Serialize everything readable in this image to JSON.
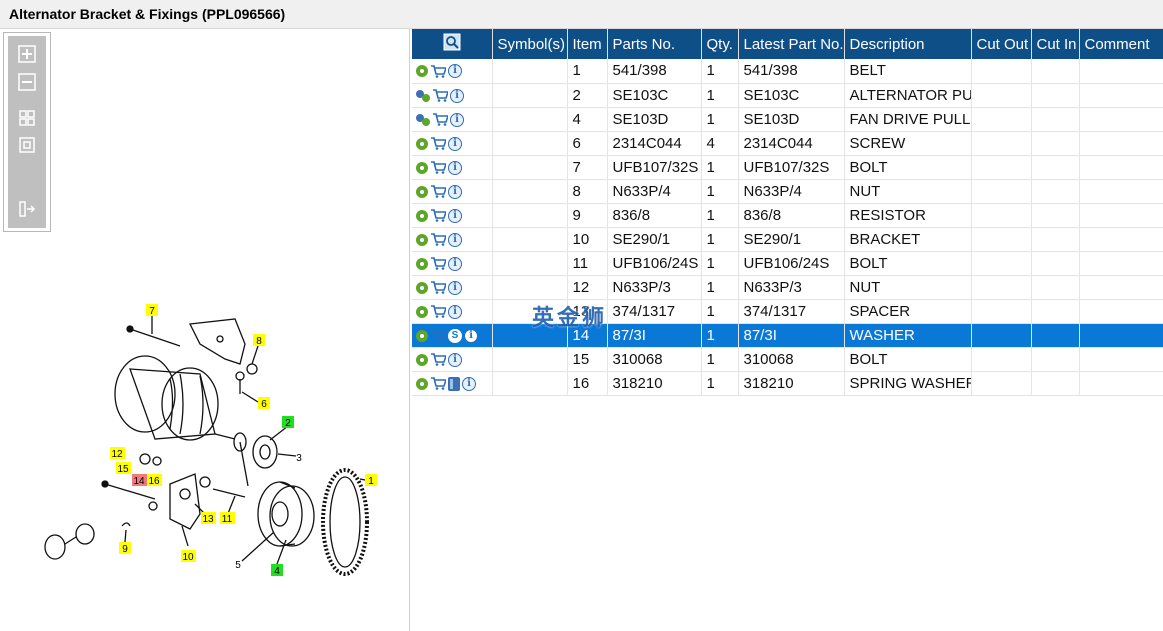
{
  "title": "Alternator Bracket & Fixings (PPL096566)",
  "toolbar": {
    "buttons": [
      {
        "name": "zoom-in",
        "icon": "plus-icon"
      },
      {
        "name": "zoom-out",
        "icon": "minus-icon"
      },
      {
        "name": "fit-all",
        "icon": "grid-icon"
      },
      {
        "name": "actual-size",
        "icon": "square-icon"
      },
      {
        "name": "split-view",
        "icon": "panel-arrow-icon"
      }
    ]
  },
  "diagram": {
    "callouts": [
      "7",
      "8",
      "6",
      "2",
      "3",
      "12",
      "15",
      "14",
      "16",
      "13",
      "11",
      "9",
      "10",
      "5",
      "4",
      "1"
    ]
  },
  "table": {
    "headers": [
      "",
      "Symbol(s)",
      "Item",
      "Parts No.",
      "Qty.",
      "Latest Part No.",
      "Description",
      "Cut Out",
      "Cut In",
      "Comment"
    ],
    "rows": [
      {
        "icon": "gear",
        "extra": "",
        "item": "1",
        "part": "541/398",
        "qty": "1",
        "latest": "541/398",
        "desc": "BELT",
        "selected": false
      },
      {
        "icon": "gears",
        "extra": "",
        "item": "2",
        "part": "SE103C",
        "qty": "1",
        "latest": "SE103C",
        "desc": "ALTERNATOR PULLEY",
        "selected": false
      },
      {
        "icon": "gears",
        "extra": "",
        "item": "4",
        "part": "SE103D",
        "qty": "1",
        "latest": "SE103D",
        "desc": "FAN DRIVE PULLEY",
        "selected": false
      },
      {
        "icon": "gear",
        "extra": "",
        "item": "6",
        "part": "2314C044",
        "qty": "4",
        "latest": "2314C044",
        "desc": "SCREW",
        "selected": false
      },
      {
        "icon": "gear",
        "extra": "",
        "item": "7",
        "part": "UFB107/32S",
        "qty": "1",
        "latest": "UFB107/32S",
        "desc": "BOLT",
        "selected": false
      },
      {
        "icon": "gear",
        "extra": "",
        "item": "8",
        "part": "N633P/4",
        "qty": "1",
        "latest": "N633P/4",
        "desc": "NUT",
        "selected": false
      },
      {
        "icon": "gear",
        "extra": "",
        "item": "9",
        "part": "836/8",
        "qty": "1",
        "latest": "836/8",
        "desc": "RESISTOR",
        "selected": false
      },
      {
        "icon": "gear",
        "extra": "",
        "item": "10",
        "part": "SE290/1",
        "qty": "1",
        "latest": "SE290/1",
        "desc": "BRACKET",
        "selected": false
      },
      {
        "icon": "gear",
        "extra": "",
        "item": "11",
        "part": "UFB106/24S",
        "qty": "1",
        "latest": "UFB106/24S",
        "desc": "BOLT",
        "selected": false
      },
      {
        "icon": "gear",
        "extra": "",
        "item": "12",
        "part": "N633P/3",
        "qty": "1",
        "latest": "N633P/3",
        "desc": "NUT",
        "selected": false
      },
      {
        "icon": "gear",
        "extra": "",
        "item": "13",
        "part": "374/1317",
        "qty": "1",
        "latest": "374/1317",
        "desc": "SPACER",
        "selected": false
      },
      {
        "icon": "gear",
        "extra": "S",
        "item": "14",
        "part": "87/3I",
        "qty": "1",
        "latest": "87/3I",
        "desc": "WASHER",
        "selected": true
      },
      {
        "icon": "gear",
        "extra": "",
        "item": "15",
        "part": "310068",
        "qty": "1",
        "latest": "310068",
        "desc": "BOLT",
        "selected": false
      },
      {
        "icon": "gear",
        "extra": "book",
        "item": "16",
        "part": "318210",
        "qty": "1",
        "latest": "318210",
        "desc": "SPRING WASHER",
        "selected": false
      }
    ]
  },
  "watermark": "英金狮",
  "colors": {
    "header_bg": "#0e4f88",
    "selected_bg": "#0a78d7",
    "callout_yellow": "#ffff00",
    "callout_green": "#22dd22",
    "callout_red": "#f07a7a"
  }
}
